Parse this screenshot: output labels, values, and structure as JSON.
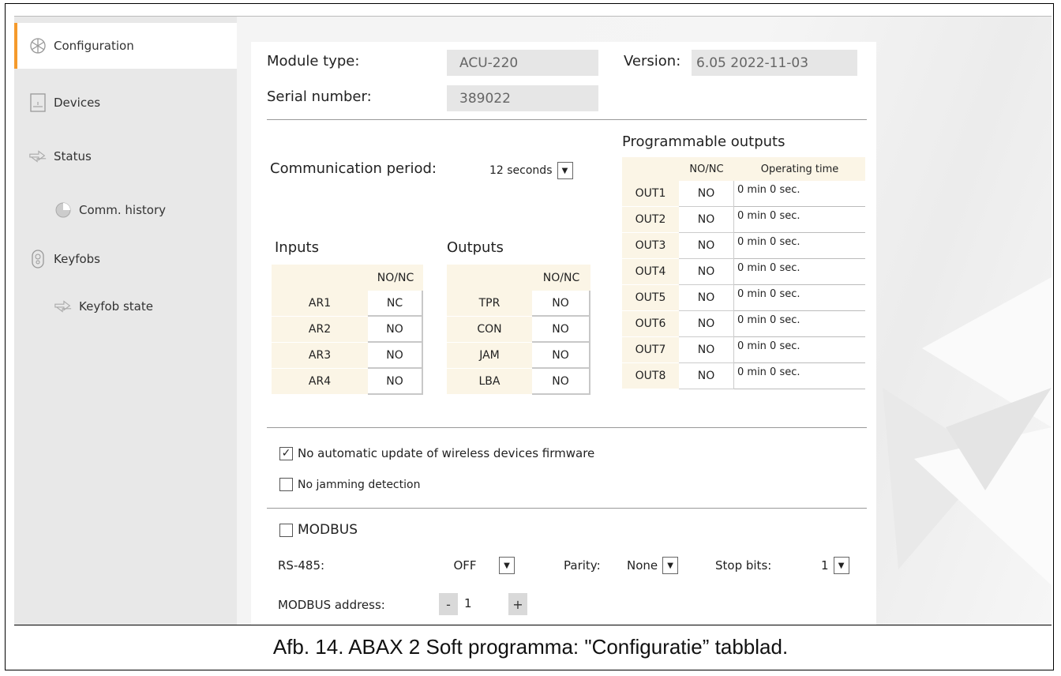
{
  "sidebar": {
    "items": [
      {
        "label": "Configuration",
        "icon": "snowflake-icon",
        "active": true
      },
      {
        "label": "Devices",
        "icon": "device-icon",
        "active": false
      },
      {
        "label": "Status",
        "icon": "arrows-icon",
        "active": false
      },
      {
        "label": "Comm. history",
        "icon": "clock-icon",
        "active": false
      },
      {
        "label": "Keyfobs",
        "icon": "keyfob-icon",
        "active": false
      },
      {
        "label": "Keyfob state",
        "icon": "arrows-icon",
        "active": false
      }
    ]
  },
  "module": {
    "module_type_label": "Module type:",
    "module_type_value": "ACU-220",
    "version_label": "Version:",
    "version_value": "6.05 2022-11-03",
    "serial_label": "Serial number:",
    "serial_value": "389022"
  },
  "comm": {
    "label": "Communication period:",
    "value": "12 seconds"
  },
  "inputs": {
    "title": "Inputs",
    "header": "NO/NC",
    "rows": [
      {
        "name": "AR1",
        "value": "NC"
      },
      {
        "name": "AR2",
        "value": "NO"
      },
      {
        "name": "AR3",
        "value": "NO"
      },
      {
        "name": "AR4",
        "value": "NO"
      }
    ]
  },
  "outputs": {
    "title": "Outputs",
    "header": "NO/NC",
    "rows": [
      {
        "name": "TPR",
        "value": "NO"
      },
      {
        "name": "CON",
        "value": "NO"
      },
      {
        "name": "JAM",
        "value": "NO"
      },
      {
        "name": "LBA",
        "value": "NO"
      }
    ]
  },
  "prog_outputs": {
    "title": "Programmable outputs",
    "header_nonc": "NO/NC",
    "header_time": "Operating time",
    "rows": [
      {
        "name": "OUT1",
        "value": "NO",
        "time": "0 min 0 sec."
      },
      {
        "name": "OUT2",
        "value": "NO",
        "time": "0 min 0 sec."
      },
      {
        "name": "OUT3",
        "value": "NO",
        "time": "0 min 0 sec."
      },
      {
        "name": "OUT4",
        "value": "NO",
        "time": "0 min 0 sec."
      },
      {
        "name": "OUT5",
        "value": "NO",
        "time": "0 min 0 sec."
      },
      {
        "name": "OUT6",
        "value": "NO",
        "time": "0 min 0 sec."
      },
      {
        "name": "OUT7",
        "value": "NO",
        "time": "0 min 0 sec."
      },
      {
        "name": "OUT8",
        "value": "NO",
        "time": "0 min 0 sec."
      }
    ]
  },
  "options": {
    "no_auto_update": {
      "label": "No automatic update of wireless devices firmware",
      "checked": true
    },
    "no_jamming": {
      "label": "No jamming detection",
      "checked": false
    }
  },
  "modbus": {
    "label": "MODBUS",
    "checked": false,
    "rs485_label": "RS-485:",
    "rs485_value": "OFF",
    "parity_label": "Parity:",
    "parity_value": "None",
    "stopbits_label": "Stop bits:",
    "stopbits_value": "1",
    "address_label": "MODBUS address:",
    "address_value": "1",
    "minus": "-",
    "plus": "+"
  },
  "caption": "Afb. 14. ABAX 2 Soft programma: \"Configuratie” tabblad.",
  "colors": {
    "accent": "#f59a2c",
    "sidebar": "#e8e8e8",
    "table_header": "#fbf5e6"
  }
}
